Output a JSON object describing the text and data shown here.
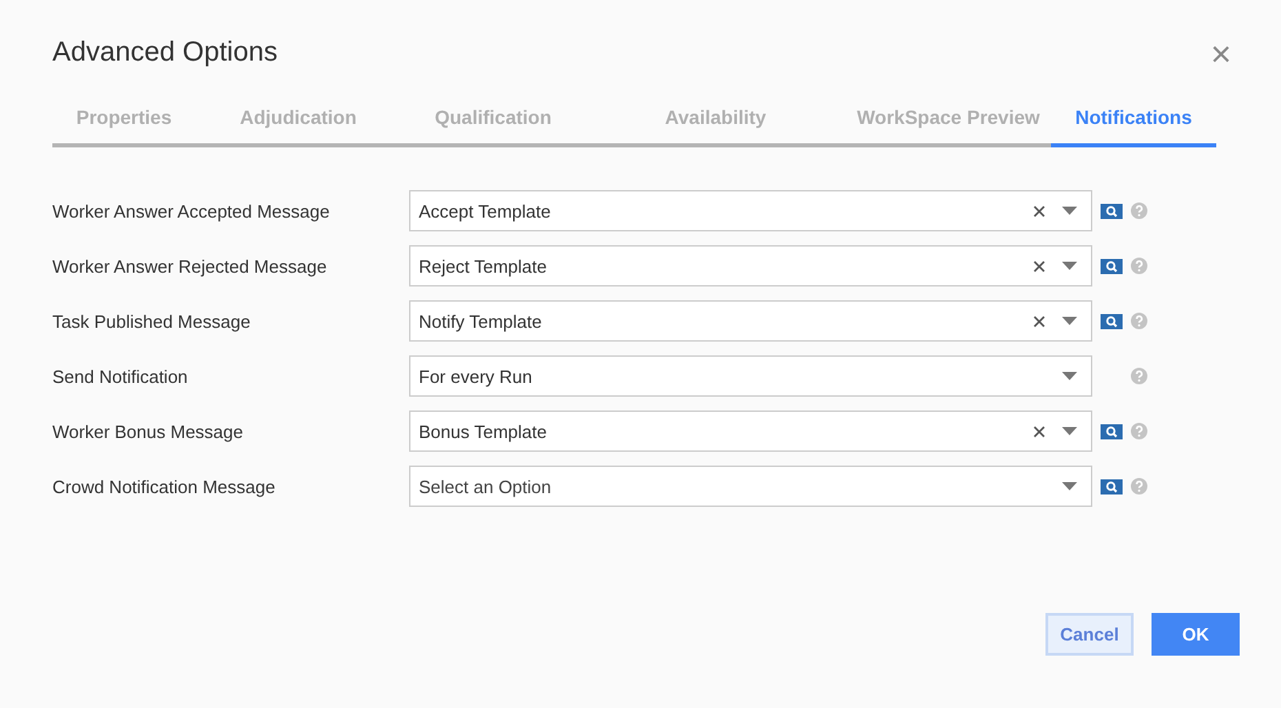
{
  "dialog": {
    "title": "Advanced Options",
    "close": "×"
  },
  "tabs": [
    {
      "label": "Properties",
      "selected": false
    },
    {
      "label": "Adjudication",
      "selected": false
    },
    {
      "label": "Qualification",
      "selected": false
    },
    {
      "label": "Availability",
      "selected": false
    },
    {
      "label": "WorkSpace Preview",
      "selected": false
    },
    {
      "label": "Notifications",
      "selected": true
    }
  ],
  "fields": [
    {
      "label": "Worker Answer Accepted Message",
      "value": "Accept Template",
      "clearable": true,
      "lookup": true
    },
    {
      "label": "Worker Answer Rejected Message",
      "value": "Reject Template",
      "clearable": true,
      "lookup": true
    },
    {
      "label": "Task Published Message",
      "value": "Notify Template",
      "clearable": true,
      "lookup": true
    },
    {
      "label": "Send Notification",
      "value": "For every Run",
      "clearable": false,
      "lookup": false
    },
    {
      "label": "Worker Bonus Message",
      "value": "Bonus Template",
      "clearable": true,
      "lookup": true
    },
    {
      "label": "Crowd Notification Message",
      "placeholder": "Select an Option",
      "clearable": false,
      "lookup": true
    }
  ],
  "buttons": [
    {
      "label": "Cancel",
      "kind": "secondary"
    },
    {
      "label": "OK",
      "kind": "primary"
    }
  ]
}
